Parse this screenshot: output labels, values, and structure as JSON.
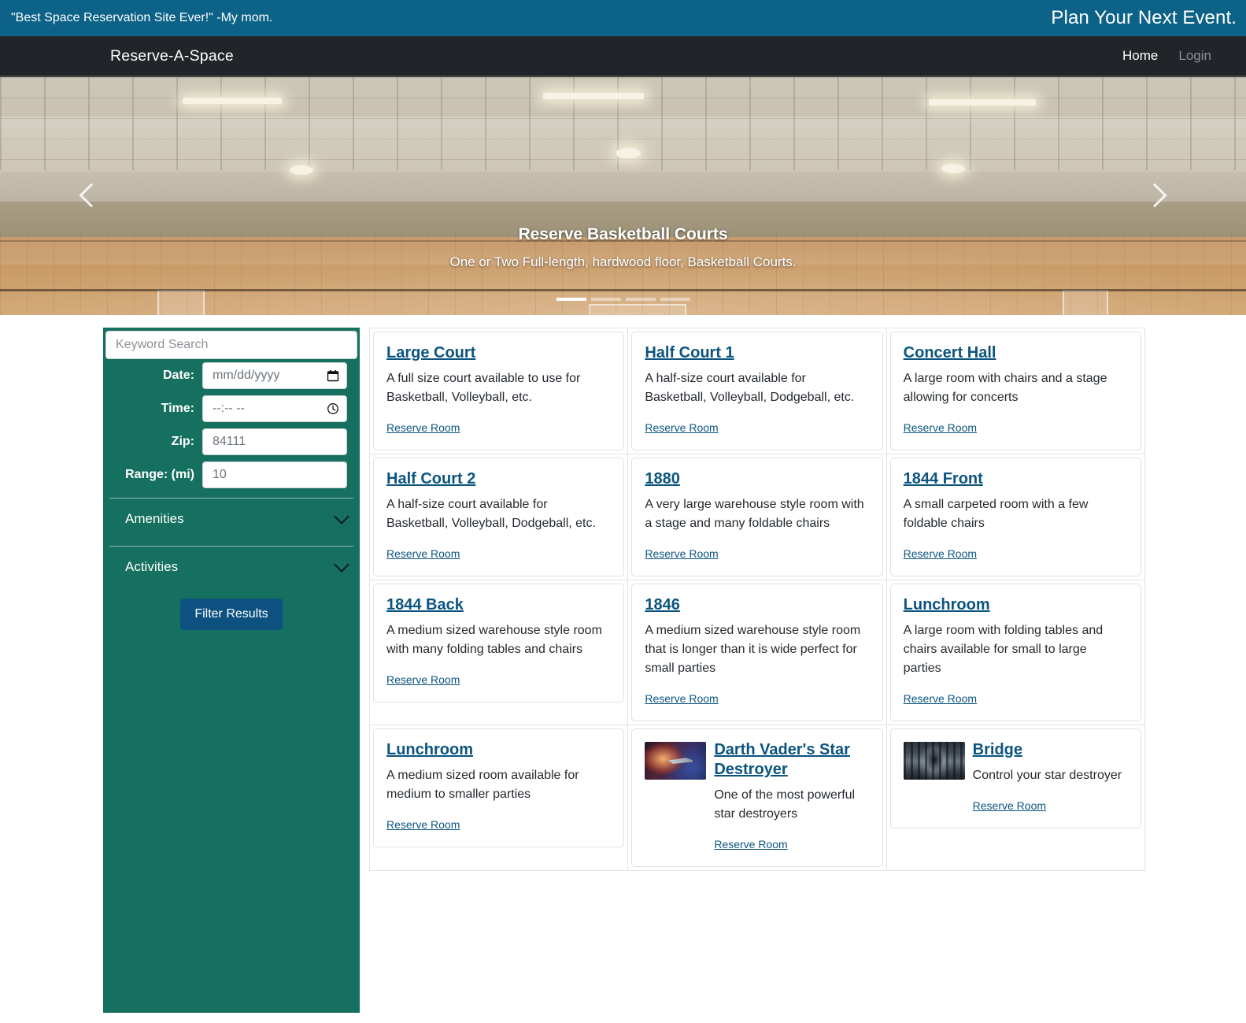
{
  "tagline": {
    "left": "\"Best Space Reservation Site Ever!\" -My mom.",
    "right": "Plan Your Next Event."
  },
  "navbar": {
    "brand": "Reserve-A-Space",
    "links": [
      {
        "label": "Home",
        "active": true
      },
      {
        "label": "Login",
        "active": false
      }
    ]
  },
  "carousel": {
    "title": "Reserve Basketball Courts",
    "subtitle": "One or Two Full-length, hardwood floor, Basketball Courts.",
    "prev_icon": "chevron-left-icon",
    "next_icon": "chevron-right-icon",
    "slide_count": 4,
    "active_slide": 1
  },
  "filters": {
    "keyword": {
      "value": "",
      "placeholder": "Keyword Search"
    },
    "date": {
      "label": "Date:",
      "value": "",
      "placeholder": "mm/dd/yyyy",
      "icon": "calendar-icon"
    },
    "time": {
      "label": "Time:",
      "value": "",
      "placeholder": "--:-- --",
      "icon": "clock-icon"
    },
    "zip": {
      "label": "Zip:",
      "value": "84111",
      "placeholder": "84111"
    },
    "range": {
      "label": "Range: (mi)",
      "value": "10",
      "placeholder": "10"
    },
    "accordions": [
      {
        "label": "Amenities",
        "icon": "chevron-down-icon"
      },
      {
        "label": "Activities",
        "icon": "chevron-down-icon"
      }
    ],
    "submit_label": "Filter Results"
  },
  "results": {
    "reserve_label": "Reserve Room",
    "rows": [
      [
        {
          "title": "Large Court",
          "desc": "A full size court available to use for Basketball, Volleyball, etc.",
          "thumb": null
        },
        {
          "title": "Half Court 1",
          "desc": "A half-size court available for Basketball, Volleyball, Dodgeball, etc.",
          "thumb": null
        },
        {
          "title": "Concert Hall",
          "desc": "A large room with chairs and a stage allowing for concerts",
          "thumb": null
        }
      ],
      [
        {
          "title": "Half Court 2",
          "desc": "A half-size court available for Basketball, Volleyball, Dodgeball, etc.",
          "thumb": null
        },
        {
          "title": "1880",
          "desc": "A very large warehouse style room with a stage and many foldable chairs",
          "thumb": null
        },
        {
          "title": "1844 Front",
          "desc": "A small carpeted room with a few foldable chairs",
          "thumb": null
        }
      ],
      [
        {
          "title": "1844 Back",
          "desc": "A medium sized warehouse style room with many folding tables and chairs",
          "thumb": null
        },
        {
          "title": "1846",
          "desc": "A medium sized warehouse style room that is longer than it is wide perfect for small parties",
          "thumb": null
        },
        {
          "title": "Lunchroom",
          "desc": "A large room with folding tables and chairs available for small to large parties",
          "thumb": null
        }
      ],
      [
        {
          "title": "Lunchroom",
          "desc": "A medium sized room available for medium to smaller parties",
          "thumb": null
        },
        {
          "title": "Darth Vader's Star Destroyer",
          "desc": "One of the most powerful star destroyers",
          "thumb": "star-destroyer-thumbnail"
        },
        {
          "title": "Bridge",
          "desc": "Control your star destroyer",
          "thumb": "bridge-thumbnail"
        }
      ]
    ]
  },
  "colors": {
    "tagline_bar": "#0d6288",
    "navbar": "#212529",
    "filter_panel": "#16705f",
    "button": "#0d5180",
    "link": "#0b5480"
  }
}
